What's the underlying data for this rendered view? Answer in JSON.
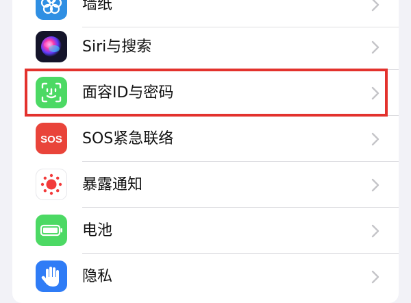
{
  "settings_list": {
    "items": [
      {
        "label": "墙纸",
        "icon": "wallpaper-flower-icon",
        "icon_color": "#2f8fe3"
      },
      {
        "label": "Siri与搜索",
        "icon": "siri-orb-icon",
        "icon_color": "#1b1b2b"
      },
      {
        "label": "面容ID与密码",
        "icon": "face-id-icon",
        "icon_color": "#4cd964"
      },
      {
        "label": "SOS紧急联络",
        "icon": "sos-icon",
        "icon_color": "#e9443a",
        "icon_text": "SOS"
      },
      {
        "label": "暴露通知",
        "icon": "exposure-notification-icon",
        "icon_color": "#ffffff"
      },
      {
        "label": "电池",
        "icon": "battery-icon",
        "icon_color": "#4cd964"
      },
      {
        "label": "隐私",
        "icon": "privacy-hand-icon",
        "icon_color": "#2f7cf6"
      }
    ]
  },
  "highlight": {
    "color": "#e3322d",
    "target": "面容ID与密码"
  }
}
